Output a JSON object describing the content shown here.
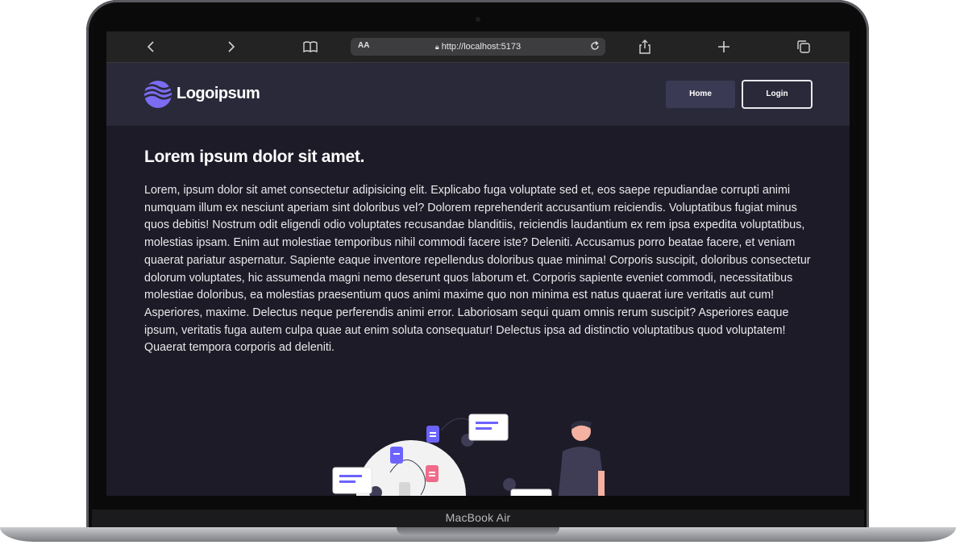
{
  "device": {
    "label": "MacBook Air"
  },
  "browser": {
    "url": "http://localhost:5173",
    "text_size_label": "AA",
    "icons": [
      "back-icon",
      "forward-icon",
      "book-icon",
      "reload-icon",
      "share-icon",
      "new-tab-icon",
      "tabs-icon"
    ]
  },
  "site": {
    "logo_text": "Logoipsum",
    "nav": {
      "home": "Home",
      "login": "Login"
    },
    "title": "Lorem ipsum dolor sit amet.",
    "paragraph": "Lorem, ipsum dolor sit amet consectetur adipisicing elit. Explicabo fuga voluptate sed et, eos saepe repudiandae corrupti animi numquam illum ex nesciunt aperiam sint doloribus vel? Dolorem reprehenderit accusantium reiciendis. Voluptatibus fugiat minus quos debitis! Nostrum odit eligendi odio voluptates recusandae blanditiis, reiciendis laudantium ex rem ipsa expedita voluptatibus, molestias ipsam. Enim aut molestiae temporibus nihil commodi facere iste? Deleniti. Accusamus porro beatae facere, et veniam quaerat pariatur aspernatur. Sapiente eaque inventore repellendus doloribus quae minima! Corporis suscipit, doloribus consectetur dolorum voluptates, hic assumenda magni nemo deserunt quos laborum et. Corporis sapiente eveniet commodi, necessitatibus molestiae doloribus, ea molestias praesentium quos animi maxime quo non minima est natus quaerat iure veritatis aut cum! Asperiores, maxime. Delectus neque perferendis animi error. Laboriosam sequi quam omnis rerum suscipit? Asperiores eaque ipsum, veritatis fuga autem culpa quae aut enim soluta consequatur! Delectus ipsa ad distinctio voluptatibus quod voluptatem! Quaerat tempora corporis ad deleniti."
  },
  "colors": {
    "page_bg": "#1c1b27",
    "header_bg": "#2a2939",
    "accent_purple": "#6c63ff",
    "accent_pink": "#f06a8a"
  }
}
